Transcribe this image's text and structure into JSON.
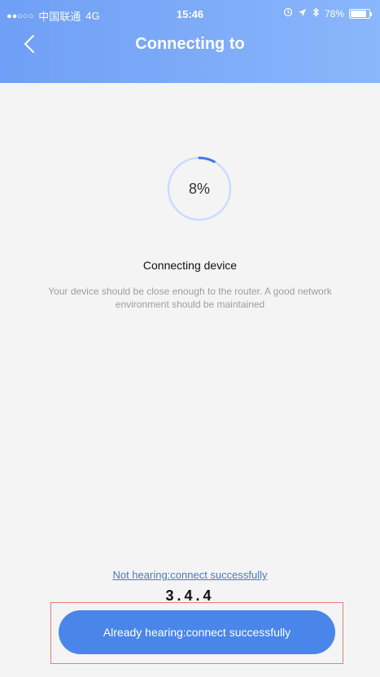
{
  "status_bar": {
    "carrier": "中国联通",
    "network": "4G",
    "time": "15:46",
    "battery": "78%",
    "signal_dots": "●●○○○",
    "icons": [
      "alarm-icon",
      "location-arrow-icon",
      "bluetooth-icon",
      "battery-icon"
    ]
  },
  "nav": {
    "title": "Connecting to",
    "back_icon": "chevron-left-icon"
  },
  "progress": {
    "value_text": "8%",
    "fraction": 0.08,
    "track_color": "#c9dbff",
    "arc_color": "#3e78e8"
  },
  "content": {
    "status_title": "Connecting device",
    "status_description": "Your device should be close enough to the router. A good network environment should be maintained"
  },
  "actions": {
    "not_hearing_link": "Not hearing:connect successfully",
    "already_hearing_button": "Already hearing:connect successfully"
  },
  "version": "3.4.4",
  "colors": {
    "header_start": "#6f9ff6",
    "header_end": "#8ab6fb",
    "button": "#4a86ea",
    "link": "#4b79c4",
    "highlight_border": "#e87c7c"
  }
}
